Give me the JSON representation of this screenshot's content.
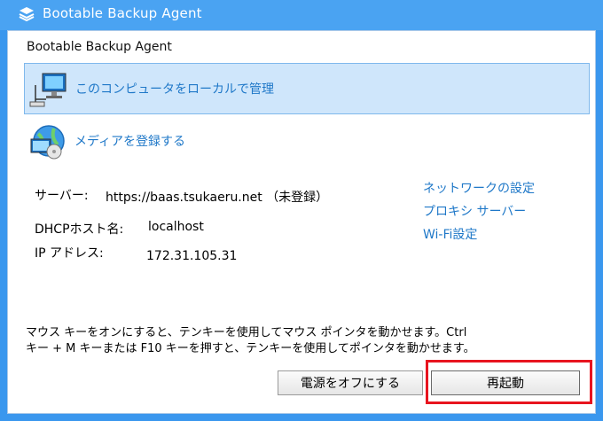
{
  "window": {
    "title": "Bootable Backup Agent"
  },
  "header": {
    "label": "Bootable Backup Agent"
  },
  "actions": [
    {
      "label": "このコンピュータをローカルで管理"
    },
    {
      "label": "メディアを登録する"
    }
  ],
  "info": {
    "server_label": "サーバー:",
    "server_value": "https://baas.tsukaeru.net （未登録）",
    "dhcp_label": "DHCPホスト名:",
    "dhcp_value": "localhost",
    "ip_label": "IP アドレス:",
    "ip_value": "172.31.105.31"
  },
  "links": {
    "network": "ネットワークの設定",
    "proxy": "プロキシ サーバー",
    "wifi": "Wi-Fi設定"
  },
  "notice": {
    "line1": "マウス キーをオンにすると、テンキーを使用してマウス ポインタを動かせます。Ctrl",
    "line2": "キー + M キーまたは F10 キーを押すと、テンキーを使用してポインタを動かせます。"
  },
  "buttons": {
    "power_off": "電源をオフにする",
    "restart": "再起動"
  },
  "colors": {
    "window_blue": "#3a97ee",
    "link_blue": "#1f78c8",
    "selection_fill": "#cfe6fb",
    "highlight_red": "#e8141f"
  }
}
